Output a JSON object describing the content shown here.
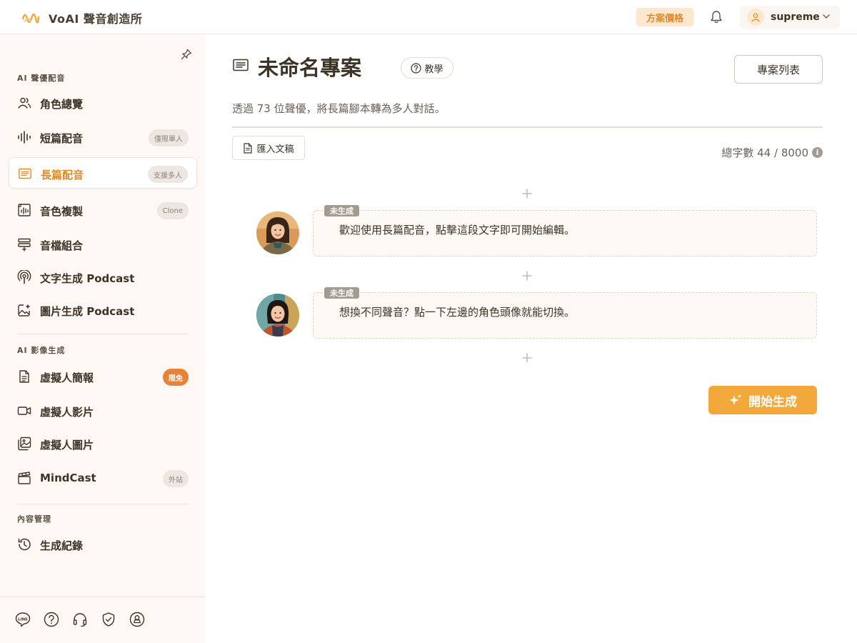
{
  "header": {
    "brand": "VoAI 聲音創造所",
    "pricing_label": "方案價格",
    "username": "supreme"
  },
  "sidebar": {
    "section_voice": "AI 聲優配音",
    "section_video": "AI 影像生成",
    "section_content": "內容管理",
    "items": [
      {
        "label": "角色總覽",
        "badge": ""
      },
      {
        "label": "短篇配音",
        "badge": "僅限單人"
      },
      {
        "label": "長篇配音",
        "badge": "支援多人"
      },
      {
        "label": "音色複製",
        "badge": "Clone"
      },
      {
        "label": "音檔組合",
        "badge": ""
      },
      {
        "label": "文字生成 Podcast",
        "badge": ""
      },
      {
        "label": "圖片生成 Podcast",
        "badge": ""
      },
      {
        "label": "虛擬人簡報",
        "badge": "限免"
      },
      {
        "label": "虛擬人影片",
        "badge": ""
      },
      {
        "label": "虛擬人圖片",
        "badge": ""
      },
      {
        "label": "MindCast",
        "badge": "外站"
      },
      {
        "label": "生成紀錄",
        "badge": ""
      }
    ],
    "active_index": 2
  },
  "main": {
    "title": "未命名專案",
    "tutorial_label": "教學",
    "projects_label": "專案列表",
    "description": "透過 73 位聲優，將長篇腳本轉為多人對話。",
    "import_label": "匯入文稿",
    "word_count": "總字數 44 / 8000",
    "info_glyph": "i",
    "dialogues": [
      {
        "status": "未生成",
        "text": "歡迎使用長篇配音，點擊這段文字即可開始編輯。"
      },
      {
        "status": "未生成",
        "text": "想換不同聲音？點一下左邊的角色頭像就能切換。"
      }
    ],
    "generate_label": "開始生成"
  },
  "colors": {
    "accent": "#e08a2a",
    "generate": "#f2a83a",
    "sidebar_bg": "#fdf8f3",
    "tag_gray": "#a39a90"
  }
}
